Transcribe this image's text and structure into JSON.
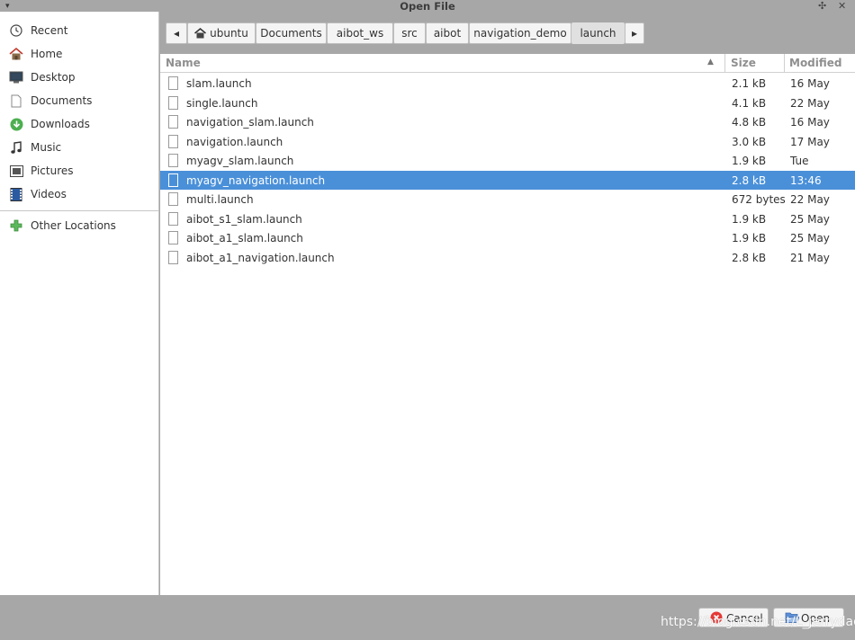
{
  "window": {
    "title": "Open File",
    "menu_glyph": "▾",
    "pin_glyph": "✣",
    "close_glyph": "✕"
  },
  "sidebar": {
    "items": [
      {
        "label": "Recent",
        "icon": "recent-icon"
      },
      {
        "label": "Home",
        "icon": "home-icon"
      },
      {
        "label": "Desktop",
        "icon": "desktop-icon"
      },
      {
        "label": "Documents",
        "icon": "documents-icon"
      },
      {
        "label": "Downloads",
        "icon": "downloads-icon"
      },
      {
        "label": "Music",
        "icon": "music-icon"
      },
      {
        "label": "Pictures",
        "icon": "pictures-icon"
      },
      {
        "label": "Videos",
        "icon": "videos-icon"
      }
    ],
    "other_locations": {
      "label": "Other Locations",
      "icon": "plus-icon"
    }
  },
  "pathbar": {
    "back_glyph": "◂",
    "forward_glyph": "▸",
    "segments": [
      "ubuntu",
      "Documents",
      "aibot_ws",
      "src",
      "aibot",
      "navigation_demo",
      "launch"
    ],
    "active_index": 6
  },
  "list": {
    "columns": {
      "name": "Name",
      "size": "Size",
      "modified": "Modified"
    },
    "sort_glyph": "▲",
    "rows": [
      {
        "name": "slam.launch",
        "size": "2.1 kB",
        "modified": "16 May"
      },
      {
        "name": "single.launch",
        "size": "4.1 kB",
        "modified": "22 May"
      },
      {
        "name": "navigation_slam.launch",
        "size": "4.8 kB",
        "modified": "16 May"
      },
      {
        "name": "navigation.launch",
        "size": "3.0 kB",
        "modified": "17 May"
      },
      {
        "name": "myagv_slam.launch",
        "size": "1.9 kB",
        "modified": "Tue"
      },
      {
        "name": "myagv_navigation.launch",
        "size": "2.8 kB",
        "modified": "13:46",
        "selected": true
      },
      {
        "name": "multi.launch",
        "size": "672 bytes",
        "modified": "22 May"
      },
      {
        "name": "aibot_s1_slam.launch",
        "size": "1.9 kB",
        "modified": "25 May"
      },
      {
        "name": "aibot_a1_slam.launch",
        "size": "1.9 kB",
        "modified": "25 May"
      },
      {
        "name": "aibot_a1_navigation.launch",
        "size": "2.8 kB",
        "modified": "21 May"
      }
    ]
  },
  "buttons": {
    "cancel": "Cancel",
    "open": "Open"
  },
  "watermark": "https://blog.csdn.net/L_jerrydad",
  "colors": {
    "accent": "#4a90d9",
    "chrome": "#a7a7a7",
    "header_text": "#8f8f8f"
  }
}
